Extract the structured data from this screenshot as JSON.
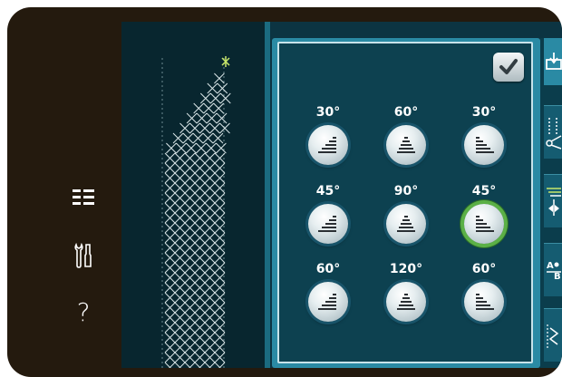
{
  "app": {
    "bezel": {
      "side_buttons": [
        "menu-list-icon",
        "tools-icon",
        "help-icon"
      ],
      "help_label": "?"
    }
  },
  "tapering": {
    "confirm_button": "checkmark-icon",
    "rows": [
      [
        {
          "angle": "30°",
          "shape": "taper-left"
        },
        {
          "angle": "60°",
          "shape": "taper-center"
        },
        {
          "angle": "30°",
          "shape": "taper-right"
        }
      ],
      [
        {
          "angle": "45°",
          "shape": "taper-left"
        },
        {
          "angle": "90°",
          "shape": "taper-center"
        },
        {
          "angle": "45°",
          "shape": "taper-right",
          "selected": true
        }
      ],
      [
        {
          "angle": "60°",
          "shape": "taper-left"
        },
        {
          "angle": "120°",
          "shape": "taper-center"
        },
        {
          "angle": "60°",
          "shape": "taper-right"
        }
      ]
    ]
  },
  "right_tabs": [
    "stitch-insert-icon",
    "tie-off-scissors-icon",
    "mirror-icon",
    "text-ab-icon",
    "zigzag-icon"
  ],
  "colors": {
    "screen_bg": "#0c3442",
    "panel_border": "#2a8aa4",
    "selected_ring": "#5bb046"
  }
}
